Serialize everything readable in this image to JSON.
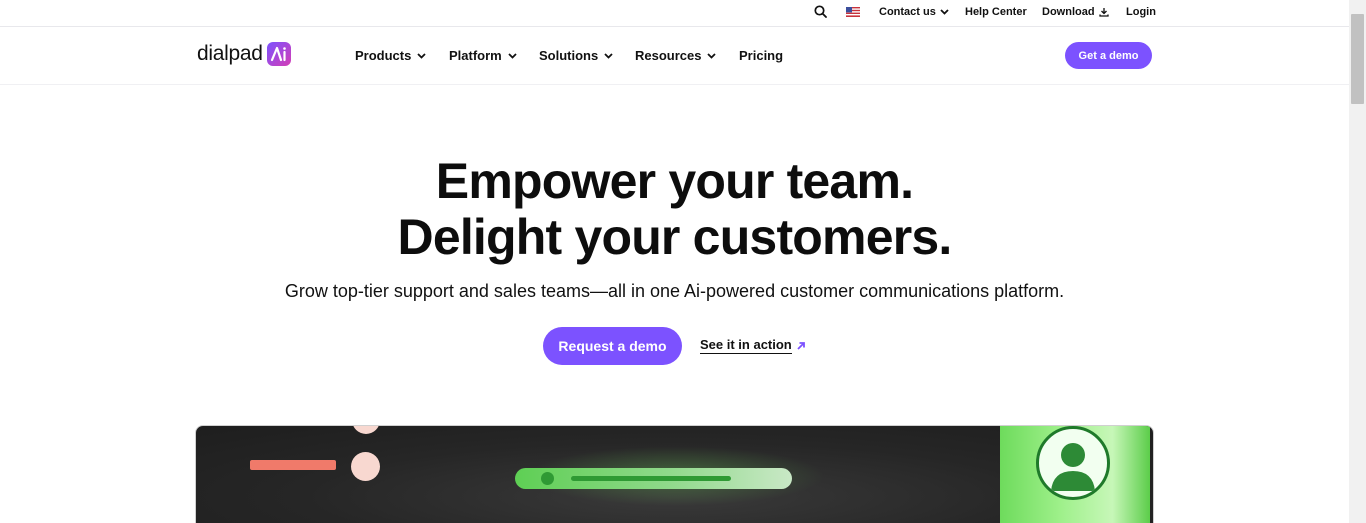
{
  "utility": {
    "contact_label": "Contact us",
    "help_label": "Help Center",
    "download_label": "Download",
    "login_label": "Login"
  },
  "nav": {
    "logo_text": "dialpad",
    "items": [
      "Products",
      "Platform",
      "Solutions",
      "Resources",
      "Pricing"
    ],
    "cta_label": "Get a demo"
  },
  "hero": {
    "title_line1": "Empower your team.",
    "title_line2": "Delight your customers.",
    "subtitle": "Grow top-tier support and sales teams—all in one Ai-powered customer communications platform.",
    "primary_label": "Request a demo",
    "secondary_label": "See it in action"
  },
  "colors": {
    "brand": "#7c52ff",
    "accent_green": "#5ecf54",
    "accent_pink": "#f07a6a"
  },
  "icons": {
    "search": "search-icon",
    "flag": "us-flag-icon",
    "chevron": "chevron-down-icon",
    "download": "download-icon",
    "arrow": "arrow-up-right-icon"
  }
}
